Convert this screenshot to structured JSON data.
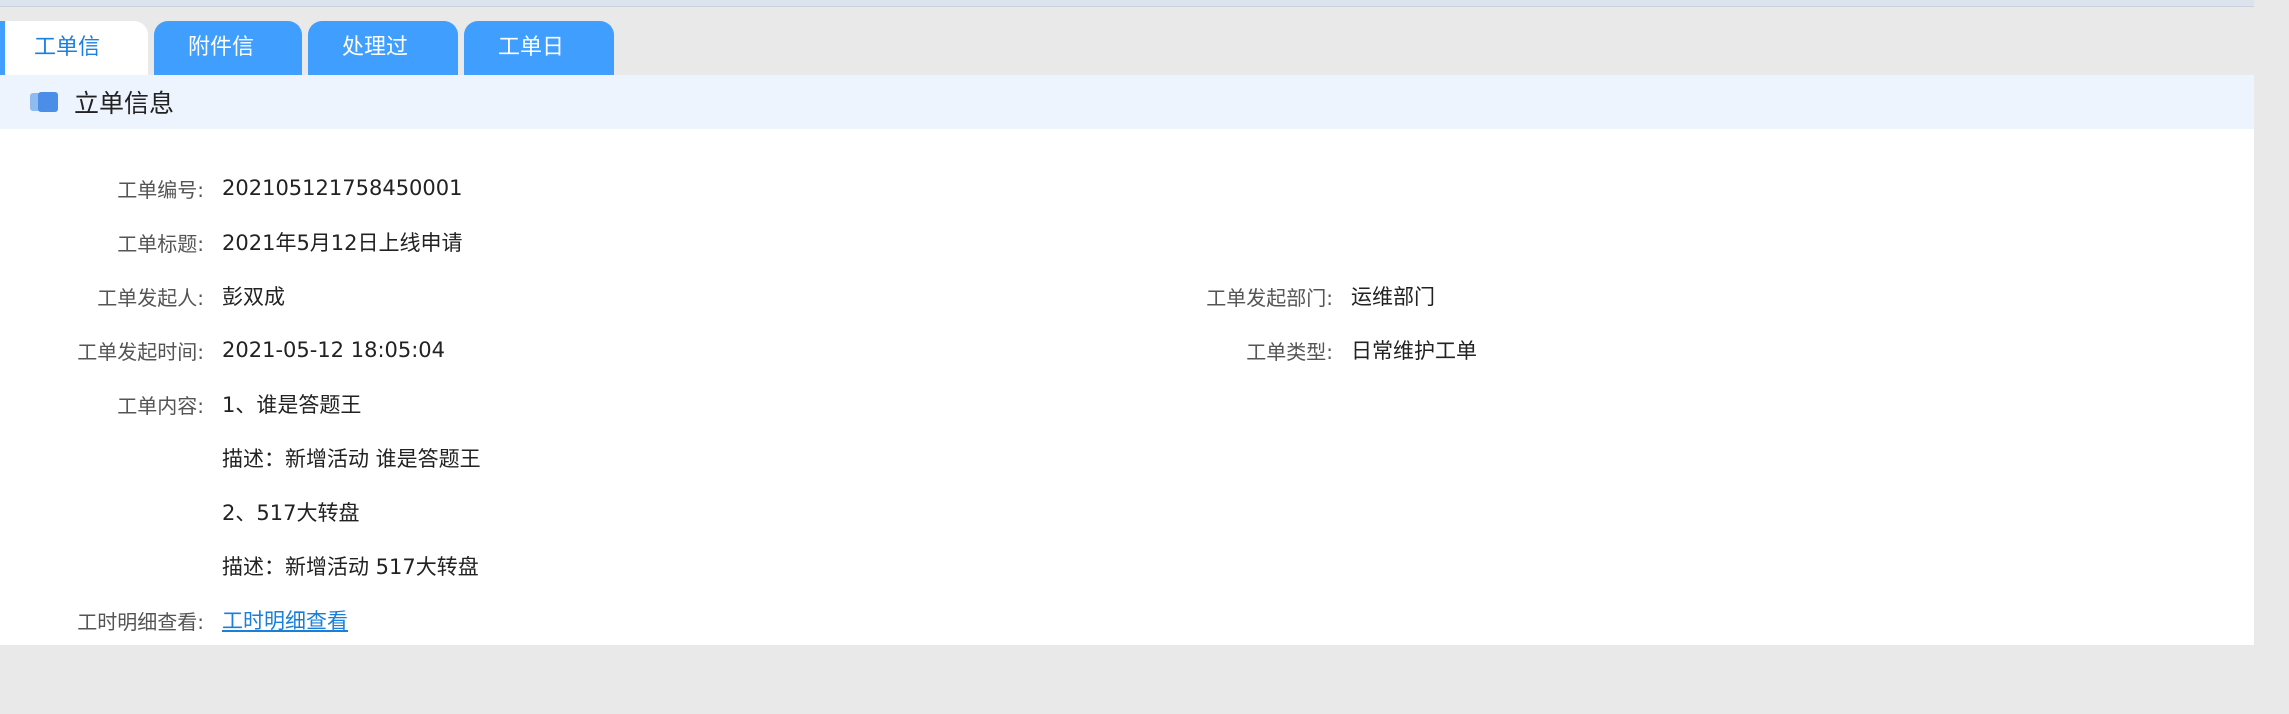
{
  "tabs": [
    {
      "label": "工单信息",
      "active": true
    },
    {
      "label": "附件信息",
      "active": false
    },
    {
      "label": "处理过程",
      "active": false
    },
    {
      "label": "工单日志",
      "active": false
    }
  ],
  "section": {
    "title": "立单信息"
  },
  "fields": {
    "order_no": {
      "label": "工单编号:",
      "value": "202105121758450001"
    },
    "order_title": {
      "label": "工单标题:",
      "value": "2021年5月12日上线申请"
    },
    "initiator": {
      "label": "工单发起人:",
      "value": "彭双成"
    },
    "initiator_dept": {
      "label": "工单发起部门:",
      "value": "运维部门"
    },
    "initiated_time": {
      "label": "工单发起时间:",
      "value": "2021-05-12 18:05:04"
    },
    "order_type": {
      "label": "工单类型:",
      "value": "日常维护工单"
    },
    "content": {
      "label": "工单内容:",
      "lines": [
        "1、谁是答题王",
        "描述：新增活动 谁是答题王",
        "2、517大转盘",
        "描述：新增活动 517大转盘"
      ]
    },
    "worktime_detail": {
      "label": "工时明细查看:",
      "link": "工时明细查看"
    }
  },
  "colors": {
    "tab_blue": "#409eff",
    "section_bg": "#eef4fd",
    "link": "#1a7fd8",
    "page_bg": "#e9e9e9"
  }
}
